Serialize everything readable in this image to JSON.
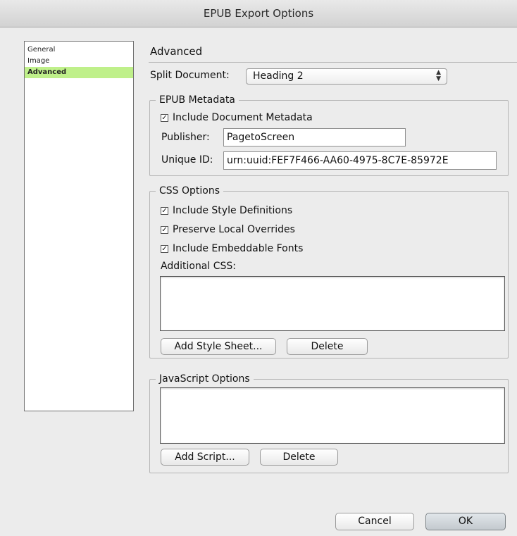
{
  "window": {
    "title": "EPUB Export Options"
  },
  "sidebar": {
    "items": [
      {
        "label": "General"
      },
      {
        "label": "Image"
      },
      {
        "label": "Advanced"
      }
    ]
  },
  "main": {
    "title": "Advanced",
    "split_document": {
      "label": "Split Document:",
      "value": "Heading 2"
    }
  },
  "epub_metadata": {
    "legend": "EPUB Metadata",
    "include_metadata": {
      "label": "Include Document Metadata",
      "checked": true
    },
    "publisher": {
      "label": "Publisher:",
      "value": "PagetoScreen"
    },
    "unique_id": {
      "label": "Unique ID:",
      "value": "urn:uuid:FEF7F466-AA60-4975-8C7E-85972E"
    }
  },
  "css_options": {
    "legend": "CSS Options",
    "include_style_definitions": {
      "label": "Include Style Definitions",
      "checked": true
    },
    "preserve_local_overrides": {
      "label": "Preserve Local Overrides",
      "checked": true
    },
    "include_embeddable_fonts": {
      "label": "Include Embeddable Fonts",
      "checked": true
    },
    "additional_css_label": "Additional CSS:",
    "add_style_sheet_label": "Add Style Sheet...",
    "delete_label": "Delete"
  },
  "javascript_options": {
    "legend": "JavaScript Options",
    "add_script_label": "Add Script...",
    "delete_label": "Delete"
  },
  "footer": {
    "cancel_label": "Cancel",
    "ok_label": "OK"
  },
  "glyphs": {
    "checkmark": "✓",
    "select_arrows_up": "▲",
    "select_arrows_down": "▼"
  },
  "colors": {
    "sidebar_selected": "#bff08a"
  }
}
